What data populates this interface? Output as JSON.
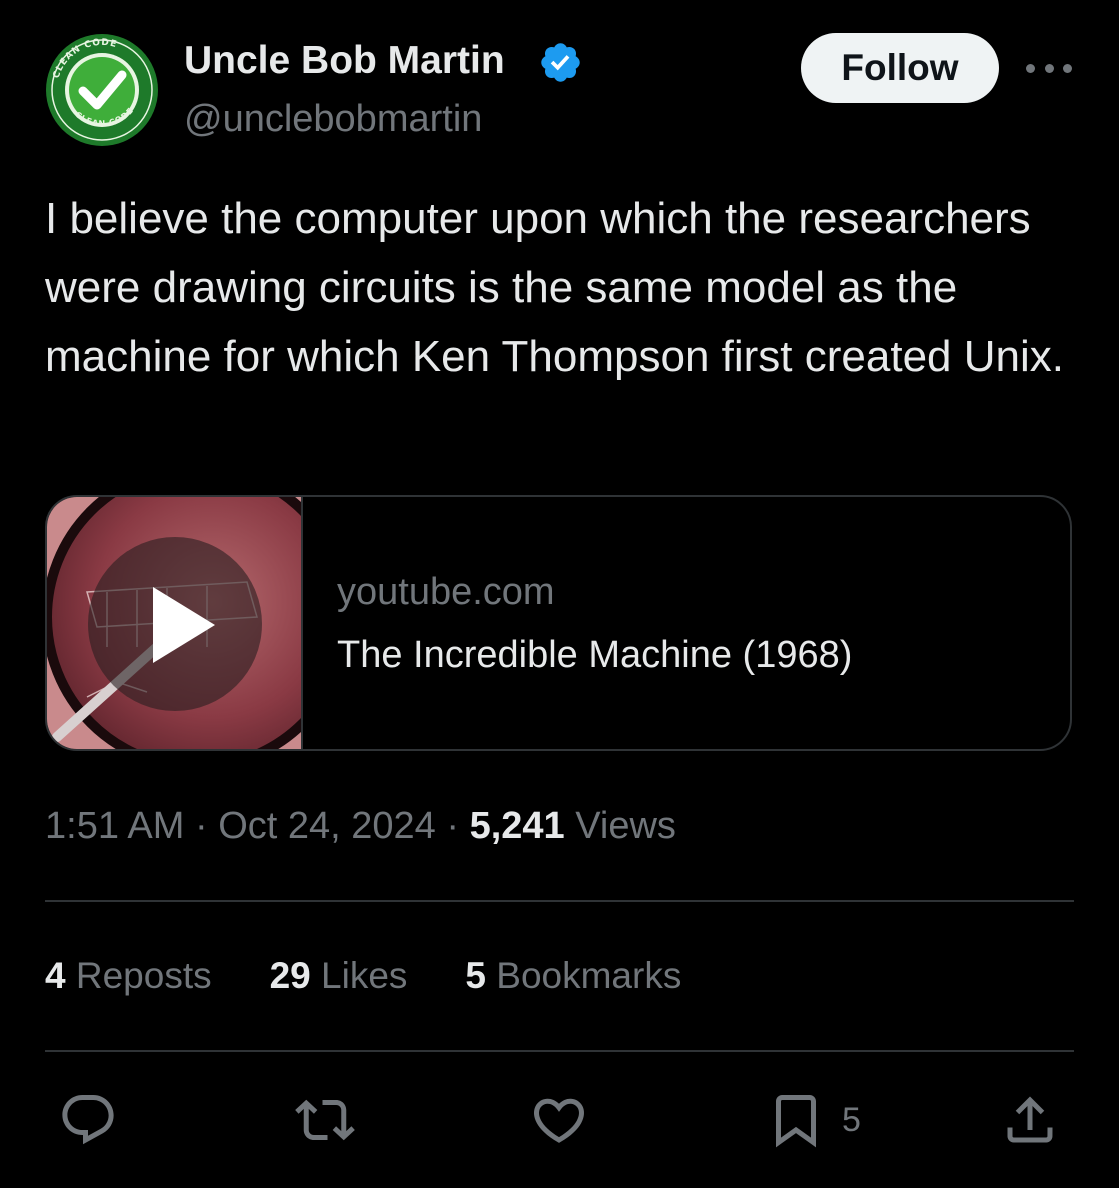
{
  "author": {
    "name": "Uncle Bob Martin",
    "handle": "@unclebobmartin",
    "avatar_badge_text": "CLEAN CODE",
    "verified_icon": "verified-badge-icon",
    "verified_color": "#1d9bf0"
  },
  "header": {
    "follow_label": "Follow",
    "more_icon": "more-options-icon"
  },
  "tweet": {
    "text": "I believe the computer upon which the researchers were drawing circuits is the same model as the machine for which Ken Thompson first created Unix."
  },
  "link_card": {
    "domain": "youtube.com",
    "title": "The Incredible Machine (1968)",
    "thumbnail_icon": "video-thumbnail-icon",
    "play_icon": "play-icon"
  },
  "meta": {
    "time": "1:51 AM",
    "separator": "·",
    "date": "Oct 24, 2024",
    "views_count": "5,241",
    "views_label": "Views"
  },
  "stats": {
    "reposts_count": "4",
    "reposts_label": "Reposts",
    "likes_count": "29",
    "likes_label": "Likes",
    "bookmarks_count": "5",
    "bookmarks_label": "Bookmarks"
  },
  "actions": {
    "reply_icon": "reply-icon",
    "repost_icon": "repost-icon",
    "like_icon": "heart-icon",
    "bookmark_icon": "bookmark-icon",
    "bookmark_count": "5",
    "share_icon": "share-icon"
  },
  "colors": {
    "background": "#000000",
    "primary_text": "#e7e9ea",
    "secondary_text": "#71767b",
    "border": "#2f3336",
    "follow_bg": "#eff3f4",
    "avatar_green": "#1f8a2b"
  }
}
